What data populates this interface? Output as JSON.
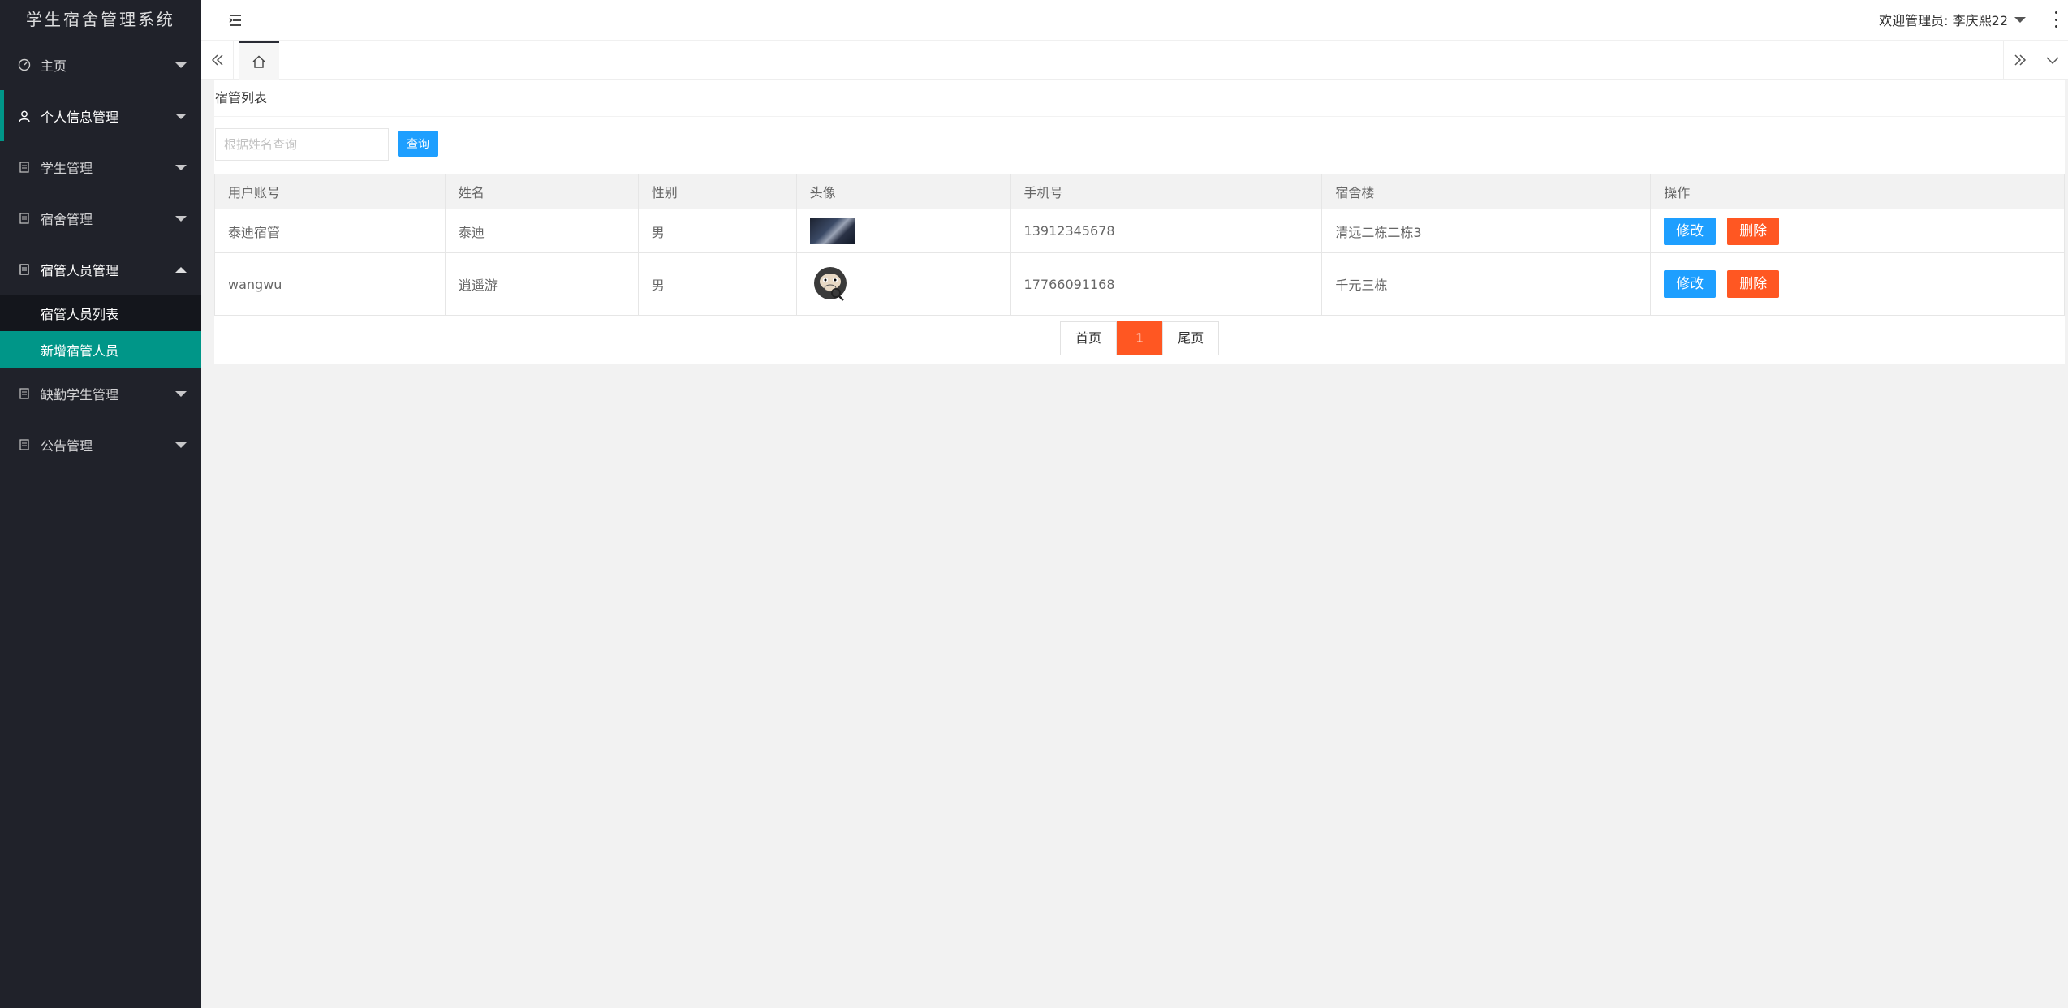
{
  "app": {
    "title": "学生宿舍管理系统"
  },
  "sidebar": {
    "items": [
      {
        "label": "主页",
        "icon": "dashboard-icon"
      },
      {
        "label": "个人信息管理",
        "icon": "user-icon"
      },
      {
        "label": "学生管理",
        "icon": "document-icon"
      },
      {
        "label": "宿舍管理",
        "icon": "document-icon"
      },
      {
        "label": "宿管人员管理",
        "icon": "document-icon",
        "expanded": true,
        "children": [
          {
            "label": "宿管人员列表"
          },
          {
            "label": "新增宿管人员",
            "selected": true
          }
        ]
      },
      {
        "label": "缺勤学生管理",
        "icon": "document-icon"
      },
      {
        "label": "公告管理",
        "icon": "document-icon"
      }
    ]
  },
  "header": {
    "welcome": "欢迎管理员: 李庆熙22"
  },
  "card": {
    "title": "宿管列表"
  },
  "search": {
    "placeholder": "根据姓名查询",
    "button": "查询"
  },
  "table": {
    "columns": [
      "用户账号",
      "姓名",
      "性别",
      "头像",
      "手机号",
      "宿舍楼",
      "操作"
    ],
    "rows": [
      {
        "account": "泰迪宿管",
        "name": "泰迪",
        "gender": "男",
        "avatar": "dark-photo",
        "phone": "13912345678",
        "building": "清远二栋二栋3",
        "edit": "修改",
        "delete": "删除"
      },
      {
        "account": "wangwu",
        "name": "逍遥游",
        "gender": "男",
        "avatar": "gorilla-cartoon",
        "phone": "17766091168",
        "building": "千元三栋",
        "edit": "修改",
        "delete": "删除"
      }
    ]
  },
  "pager": {
    "first": "首页",
    "current": "1",
    "last": "尾页"
  },
  "colors": {
    "sidebar_bg": "#20222a",
    "accent": "#009688",
    "primary": "#1e9fff",
    "danger": "#ff5722"
  }
}
